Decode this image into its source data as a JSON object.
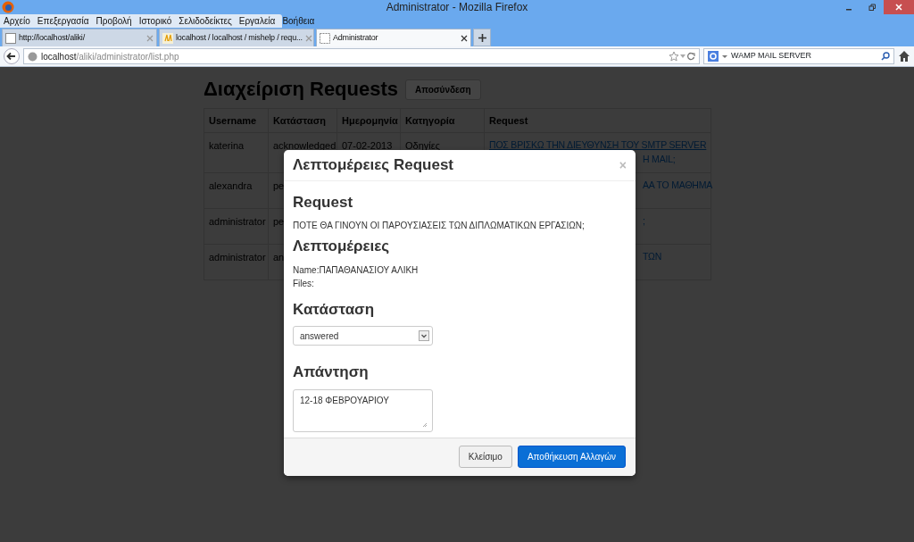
{
  "window": {
    "title": "Administrator - Mozilla Firefox"
  },
  "menu": [
    "Αρχείο",
    "Επεξεργασία",
    "Προβολή",
    "Ιστορικό",
    "Σελιδοδείκτες",
    "Εργαλεία",
    "Βοήθεια"
  ],
  "tabs": [
    {
      "label": "http://localhost/aliki/",
      "selected": false,
      "kind": "blank"
    },
    {
      "label": "localhost / localhost / mishelp / requ...",
      "selected": false,
      "kind": "pma"
    },
    {
      "label": "Administrator",
      "selected": true,
      "kind": "blank"
    }
  ],
  "address": {
    "host": "localhost",
    "path": "/aliki/administrator/list.php"
  },
  "search": {
    "value": "WAMP MAIL SERVER"
  },
  "page": {
    "heading": "Διαχείριση Requests",
    "logout_button": "Αποσύνδεση",
    "table": {
      "columns": [
        "Username",
        "Κατάσταση",
        "Ημερομηνία",
        "Κατηγορία",
        "Request"
      ],
      "rows": [
        {
          "cells": [
            "katerina",
            "acknowledged",
            "07-02-2013",
            "Οδηγίες"
          ],
          "request": [
            {
              "text": "ΠΟΣ ΒΡΙΣΚΩ ΤΗΝ ΔΙΕΥΘΥΝΣΗ ΤΟΥ SMTP SERVER",
              "kind": "full"
            },
            {
              "text": "Η MAIL;",
              "kind": "fragment"
            }
          ]
        },
        {
          "cells": [
            "alexandra",
            "pe"
          ],
          "request": [
            {
              "text": "ΑΑ ΤΟ ΜΑΘΗΜΑ",
              "kind": "fragment"
            }
          ]
        },
        {
          "cells": [
            "administrator",
            "pe"
          ],
          "request": [
            {
              "text": ";",
              "kind": "fragment"
            }
          ]
        },
        {
          "cells": [
            "administrator",
            "an"
          ],
          "request": [
            {
              "text": "ΤΩΝ",
              "kind": "fragment"
            }
          ]
        }
      ]
    }
  },
  "modal": {
    "title": "Λεπτομέρειες Request",
    "close": "×",
    "request_heading": "Request",
    "request_text": "ΠΟΤΕ ΘΑ ΓΙΝΟΥΝ ΟΙ ΠΑΡΟΥΣΙΑΣΕΙΣ ΤΩΝ ΔΙΠΛΩΜΑΤΙΚΩΝ ΕΡΓΑΣΙΩΝ;",
    "details_heading": "Λεπτομέρειες",
    "details": [
      "Name:ΠΑΠΑΘΑΝΑΣΙΟΥ ΑΛΙΚΗ",
      "Files:"
    ],
    "status_heading": "Κατάσταση",
    "status_select": {
      "value": "answered"
    },
    "answer_heading": "Απάντηση",
    "answer": {
      "value": "12-18 ΦΕΒΡΟΥΑΡΙΟΥ"
    },
    "buttons": [
      {
        "label": "Κλείσιμο",
        "kind": "secondary"
      },
      {
        "label": "Αποθήκευση Αλλαγών",
        "kind": "primary"
      }
    ]
  }
}
